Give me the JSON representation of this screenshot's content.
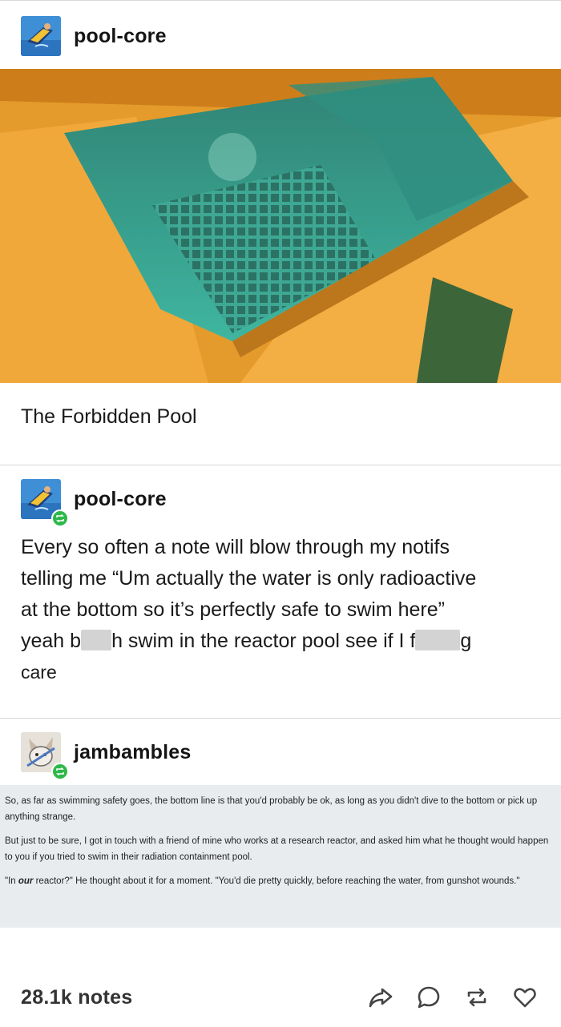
{
  "post": {
    "author": "pool-core",
    "caption": "The Forbidden Pool",
    "image_icon": "reactor-pool-photo"
  },
  "reblog1": {
    "author": "pool-core",
    "line1": "Every so often a note will blow through my notifs",
    "line2": "telling me “Um actually the water is only radioactive",
    "line3": "at the bottom so it’s perfectly safe to swim here”",
    "line4_a": "yeah b",
    "line4_b": "h swim in the reactor pool see if I f",
    "line4_c": "g",
    "line5": "care"
  },
  "reblog2": {
    "author": "jambambles",
    "p1": "So, as far as swimming safety goes, the bottom line is that you'd probably be ok, as long as you didn't dive to the bottom or pick up anything strange.",
    "p2": "But just to be sure, I got in touch with a friend of mine who works at a research reactor, and asked him what he thought would happen to you if you tried to swim in their radiation containment pool.",
    "p3_a": "\"In ",
    "p3_em": "our",
    "p3_b": " reactor?\" He thought about it for a moment. \"You'd die pretty quickly, before reaching the water, from gunshot wounds.\""
  },
  "footer": {
    "notes": "28.1k notes",
    "icons": [
      "share-icon",
      "reply-icon",
      "reblog-icon",
      "like-icon"
    ]
  },
  "colors": {
    "reblog_badge": "#2fb84a",
    "quote_bg": "#e9ecef",
    "divider": "#d6d6d6"
  }
}
